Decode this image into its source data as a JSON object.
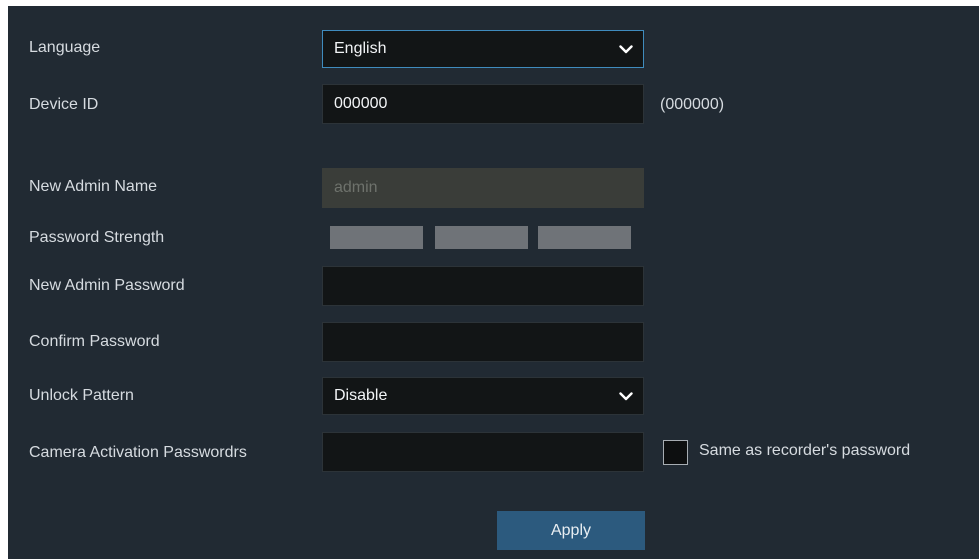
{
  "settings": {
    "language": {
      "label": "Language",
      "value": "English"
    },
    "device_id": {
      "label": "Device ID",
      "value": "000000",
      "note": "(000000)"
    },
    "admin_name": {
      "label": "New Admin Name",
      "placeholder": "admin"
    },
    "password_strength": {
      "label": "Password Strength",
      "level": 0,
      "segments": 3
    },
    "admin_password": {
      "label": "New Admin Password",
      "value": ""
    },
    "confirm_password": {
      "label": "Confirm Password",
      "value": ""
    },
    "unlock_pattern": {
      "label": "Unlock Pattern",
      "value": "Disable"
    },
    "camera_activation": {
      "label": "Camera Activation Passwordrs",
      "value": "",
      "checkbox_label": "Same as recorder's password",
      "checked": false
    },
    "apply_label": "Apply"
  },
  "colors": {
    "panel_bg": "#212a33",
    "field_bg": "#121516",
    "focus_border": "#3f8bbd",
    "apply_bg": "#2c5a7e",
    "strength_empty": "#6f7378"
  },
  "icons": {
    "dropdown": "chevron-down-icon"
  }
}
